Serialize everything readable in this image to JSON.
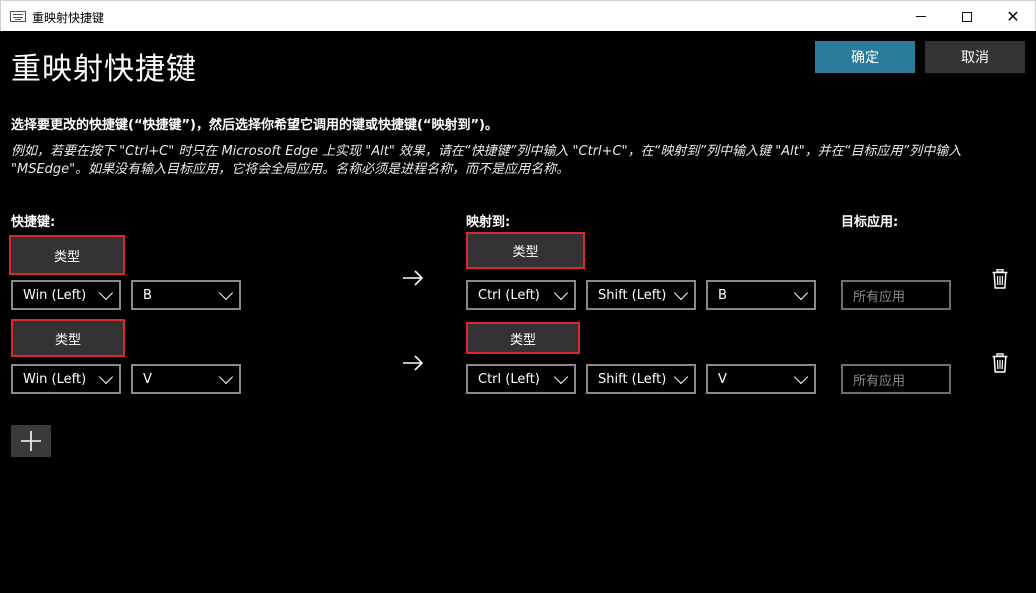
{
  "window": {
    "title": "重映射快捷键"
  },
  "header": {
    "title": "重映射快捷键",
    "ok_label": "确定",
    "cancel_label": "取消"
  },
  "instruction": "选择要更改的快捷键(“快捷键”)，然后选择你希望它调用的键或快捷键(“映射到”)。",
  "example_line1": "例如，若要在按下 \"Ctrl+C\" 时只在 Microsoft Edge 上实现 \"Alt\" 效果，请在“快捷键”列中输入 \"Ctrl+C\"，在“映射到”列中输入键 \"Alt\"，并在“目标应用”列中输入",
  "example_line2": "\"MSEdge\"。如果没有输入目标应用，它将会全局应用。名称必须是进程名称，而不是应用名称。",
  "columns": {
    "shortcut": "快捷键:",
    "mapped_to": "映射到:",
    "target_app": "目标应用:"
  },
  "type_label": "类型",
  "rows": [
    {
      "shortcut": [
        "Win (Left)",
        "B"
      ],
      "mapped": [
        "Ctrl (Left)",
        "Shift (Left)",
        "B"
      ],
      "target_placeholder": "所有应用"
    },
    {
      "shortcut": [
        "Win (Left)",
        "V"
      ],
      "mapped": [
        "Ctrl (Left)",
        "Shift (Left)",
        "V"
      ],
      "target_placeholder": "所有应用"
    }
  ],
  "icons": {
    "arrow": "arrow-right-icon",
    "delete": "trash-icon",
    "add": "plus-icon"
  },
  "colors": {
    "accent": "#2b7c9a",
    "highlight_border": "#e0262d",
    "background": "#000000"
  }
}
